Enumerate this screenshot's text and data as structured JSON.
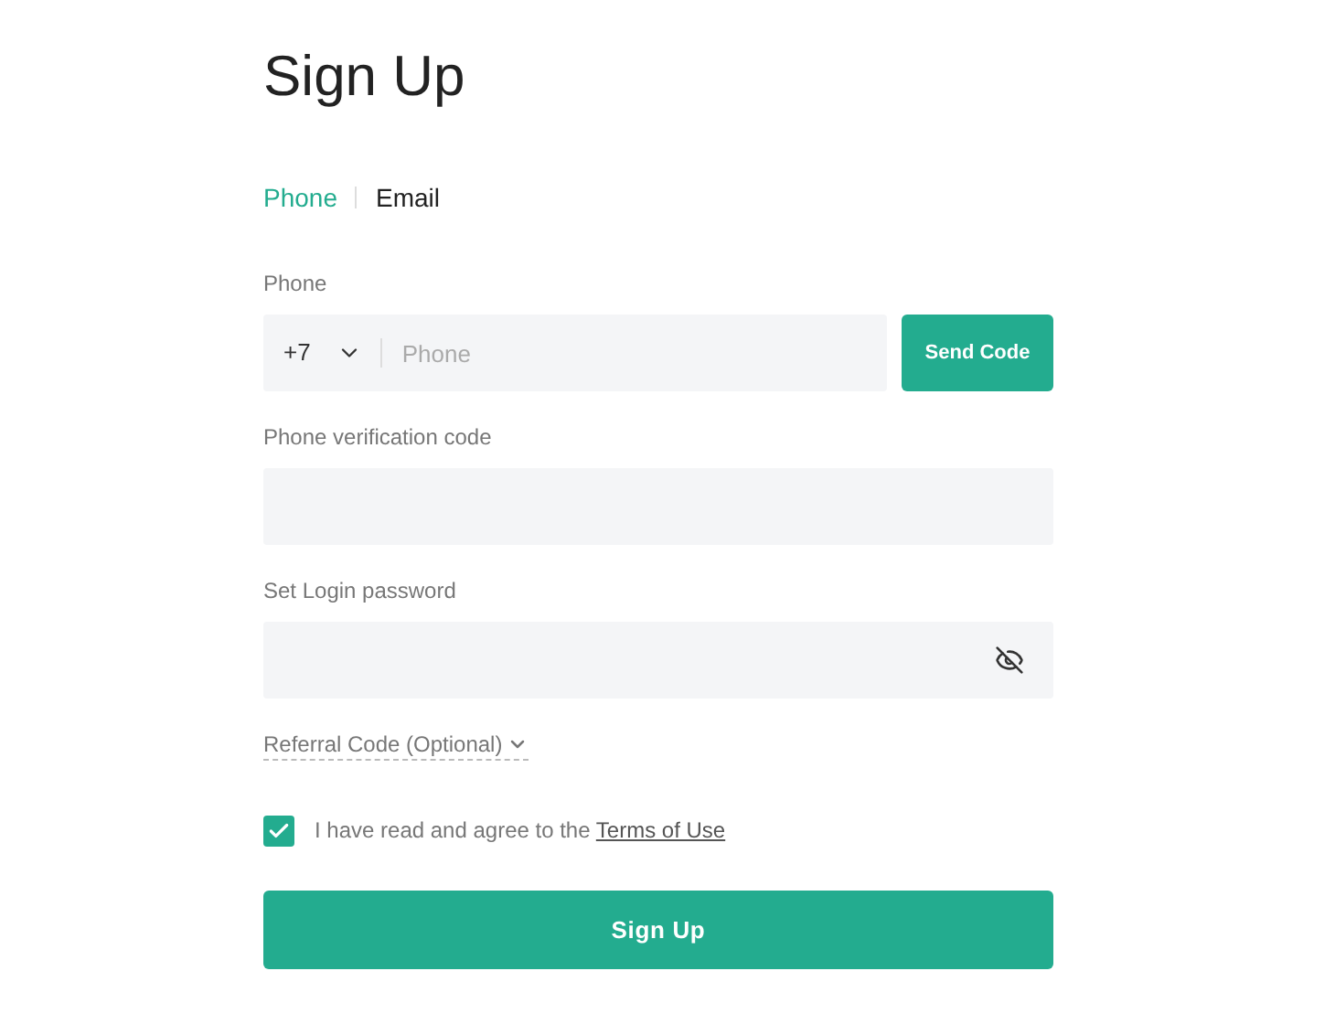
{
  "title": "Sign Up",
  "tabs": [
    {
      "label": "Phone",
      "selected": true
    },
    {
      "label": "Email",
      "selected": false
    }
  ],
  "phone": {
    "label": "Phone",
    "country_code": "+7",
    "placeholder": "Phone",
    "send_button": "Send Code"
  },
  "verification": {
    "label": "Phone verification code"
  },
  "password": {
    "label": "Set Login password"
  },
  "referral": {
    "label": "Referral Code (Optional)",
    "expanded": false
  },
  "agreement": {
    "checked": true,
    "text": "I have read and agree to the ",
    "link": "Terms of Use"
  },
  "submit": "Sign Up"
}
